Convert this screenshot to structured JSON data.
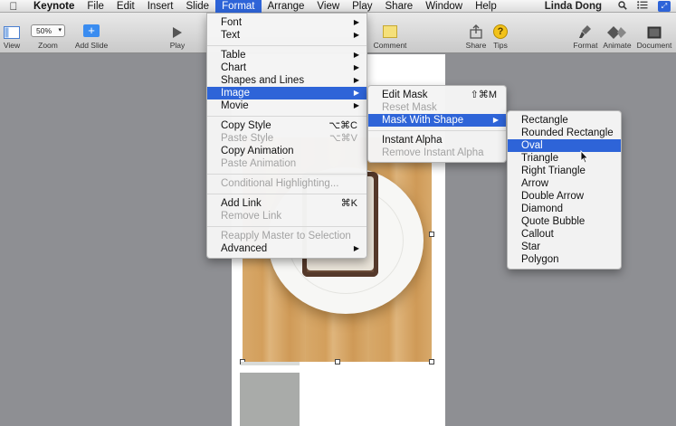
{
  "menubar": {
    "apple_icon": "apple-icon",
    "items": [
      {
        "label": "Keynote"
      },
      {
        "label": "File"
      },
      {
        "label": "Edit"
      },
      {
        "label": "Insert"
      },
      {
        "label": "Slide"
      },
      {
        "label": "Format"
      },
      {
        "label": "Arrange"
      },
      {
        "label": "View"
      },
      {
        "label": "Play"
      },
      {
        "label": "Share"
      },
      {
        "label": "Window"
      },
      {
        "label": "Help"
      }
    ],
    "user": "Linda Dong"
  },
  "toolbar": {
    "view_label": "View",
    "zoom_label": "Zoom",
    "zoom_value": "50%",
    "add_slide_label": "Add Slide",
    "play_label": "Play",
    "comment_label": "Comment",
    "share_label": "Share",
    "tips_label": "Tips",
    "format_label": "Format",
    "animate_label": "Animate",
    "document_label": "Document"
  },
  "format_menu": {
    "items": [
      {
        "label": "Font",
        "submenu": true
      },
      {
        "label": "Text",
        "submenu": true
      },
      {
        "label": "Table",
        "submenu": true
      },
      {
        "label": "Chart",
        "submenu": true
      },
      {
        "label": "Shapes and Lines",
        "submenu": true
      },
      {
        "label": "Image",
        "submenu": true,
        "selected": true
      },
      {
        "label": "Movie",
        "submenu": true
      },
      {
        "label": "Copy Style",
        "shortcut": "⌥⌘C"
      },
      {
        "label": "Paste Style",
        "shortcut": "⌥⌘V",
        "disabled": true
      },
      {
        "label": "Copy Animation"
      },
      {
        "label": "Paste Animation",
        "disabled": true
      },
      {
        "label": "Conditional Highlighting...",
        "disabled": true
      },
      {
        "label": "Add Link",
        "shortcut": "⌘K"
      },
      {
        "label": "Remove Link",
        "disabled": true
      },
      {
        "label": "Reapply Master to Selection",
        "disabled": true
      },
      {
        "label": "Advanced",
        "submenu": true
      }
    ]
  },
  "image_menu": {
    "items": [
      {
        "label": "Edit Mask",
        "shortcut": "⇧⌘M"
      },
      {
        "label": "Reset Mask",
        "disabled": true
      },
      {
        "label": "Mask With Shape",
        "submenu": true,
        "selected": true
      },
      {
        "label": "Instant Alpha"
      },
      {
        "label": "Remove Instant Alpha",
        "disabled": true
      }
    ]
  },
  "shape_menu": {
    "items": [
      {
        "label": "Rectangle"
      },
      {
        "label": "Rounded Rectangle"
      },
      {
        "label": "Oval",
        "selected": true
      },
      {
        "label": "Triangle"
      },
      {
        "label": "Right Triangle"
      },
      {
        "label": "Arrow"
      },
      {
        "label": "Double Arrow"
      },
      {
        "label": "Diamond"
      },
      {
        "label": "Quote Bubble"
      },
      {
        "label": "Callout"
      },
      {
        "label": "Star"
      },
      {
        "label": "Polygon"
      }
    ]
  },
  "colors": {
    "menu_highlight": "#2e64d8",
    "disabled_text": "#a3a3a3"
  }
}
